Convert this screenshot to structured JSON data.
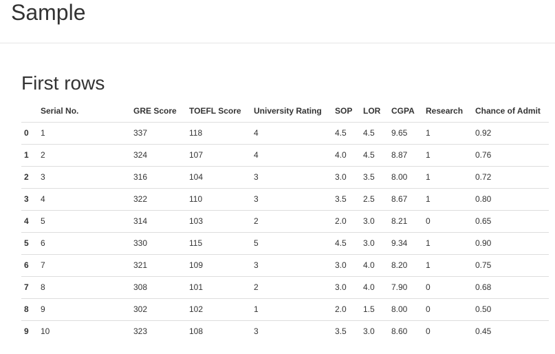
{
  "header": {
    "title": "Sample"
  },
  "section": {
    "title": "First rows"
  },
  "table": {
    "columns": [
      "",
      "Serial No.",
      "GRE Score",
      "TOEFL Score",
      "University Rating",
      "SOP",
      "LOR",
      "CGPA",
      "Research",
      "Chance of Admit"
    ],
    "rows": [
      [
        "0",
        "1",
        "337",
        "118",
        "4",
        "4.5",
        "4.5",
        "9.65",
        "1",
        "0.92"
      ],
      [
        "1",
        "2",
        "324",
        "107",
        "4",
        "4.0",
        "4.5",
        "8.87",
        "1",
        "0.76"
      ],
      [
        "2",
        "3",
        "316",
        "104",
        "3",
        "3.0",
        "3.5",
        "8.00",
        "1",
        "0.72"
      ],
      [
        "3",
        "4",
        "322",
        "110",
        "3",
        "3.5",
        "2.5",
        "8.67",
        "1",
        "0.80"
      ],
      [
        "4",
        "5",
        "314",
        "103",
        "2",
        "2.0",
        "3.0",
        "8.21",
        "0",
        "0.65"
      ],
      [
        "5",
        "6",
        "330",
        "115",
        "5",
        "4.5",
        "3.0",
        "9.34",
        "1",
        "0.90"
      ],
      [
        "6",
        "7",
        "321",
        "109",
        "3",
        "3.0",
        "4.0",
        "8.20",
        "1",
        "0.75"
      ],
      [
        "7",
        "8",
        "308",
        "101",
        "2",
        "3.0",
        "4.0",
        "7.90",
        "0",
        "0.68"
      ],
      [
        "8",
        "9",
        "302",
        "102",
        "1",
        "2.0",
        "1.5",
        "8.00",
        "0",
        "0.50"
      ],
      [
        "9",
        "10",
        "323",
        "108",
        "3",
        "3.5",
        "3.0",
        "8.60",
        "0",
        "0.45"
      ]
    ]
  }
}
